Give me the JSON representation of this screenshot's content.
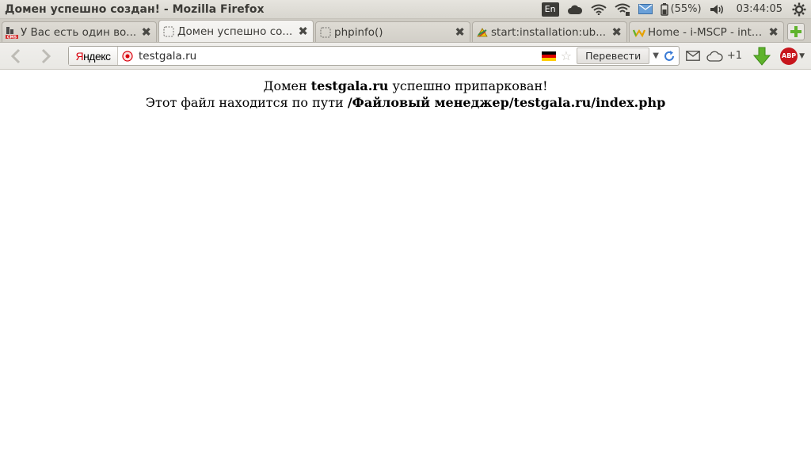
{
  "window": {
    "title": "Домен успешно создан! - Mozilla Firefox"
  },
  "system": {
    "lang": "En",
    "battery": "(55%)",
    "clock": "03:44:05"
  },
  "tabs": [
    {
      "label": "У Вас есть один во...",
      "icon": "cms-icon",
      "active": false
    },
    {
      "label": "Домен успешно со...",
      "icon": "blank-page-icon",
      "active": true
    },
    {
      "label": "phpinfo()",
      "icon": "blank-page-icon",
      "active": false
    },
    {
      "label": "start:installation:ub...",
      "icon": "dokuwiki-icon",
      "active": false
    },
    {
      "label": "Home - i-MSCP - inte...",
      "icon": "imscp-icon",
      "active": false
    }
  ],
  "toolbar": {
    "search_engine": {
      "first": "Я",
      "rest": "ндекс"
    },
    "url": "testgala.ru",
    "translate_label": "Перевести",
    "share_count": "+1"
  },
  "page": {
    "line1_prefix": "Домен ",
    "line1_domain": "testgala.ru",
    "line1_suffix": " успешно припаркован!",
    "line2_prefix": "Этот файл находится по пути ",
    "line2_path": "/Файловый менеджер/testgala.ru/index.php"
  },
  "colors": {
    "yandex_red": "#d8000c",
    "abp_red": "#c7161d",
    "download_green": "#5fb32c"
  }
}
